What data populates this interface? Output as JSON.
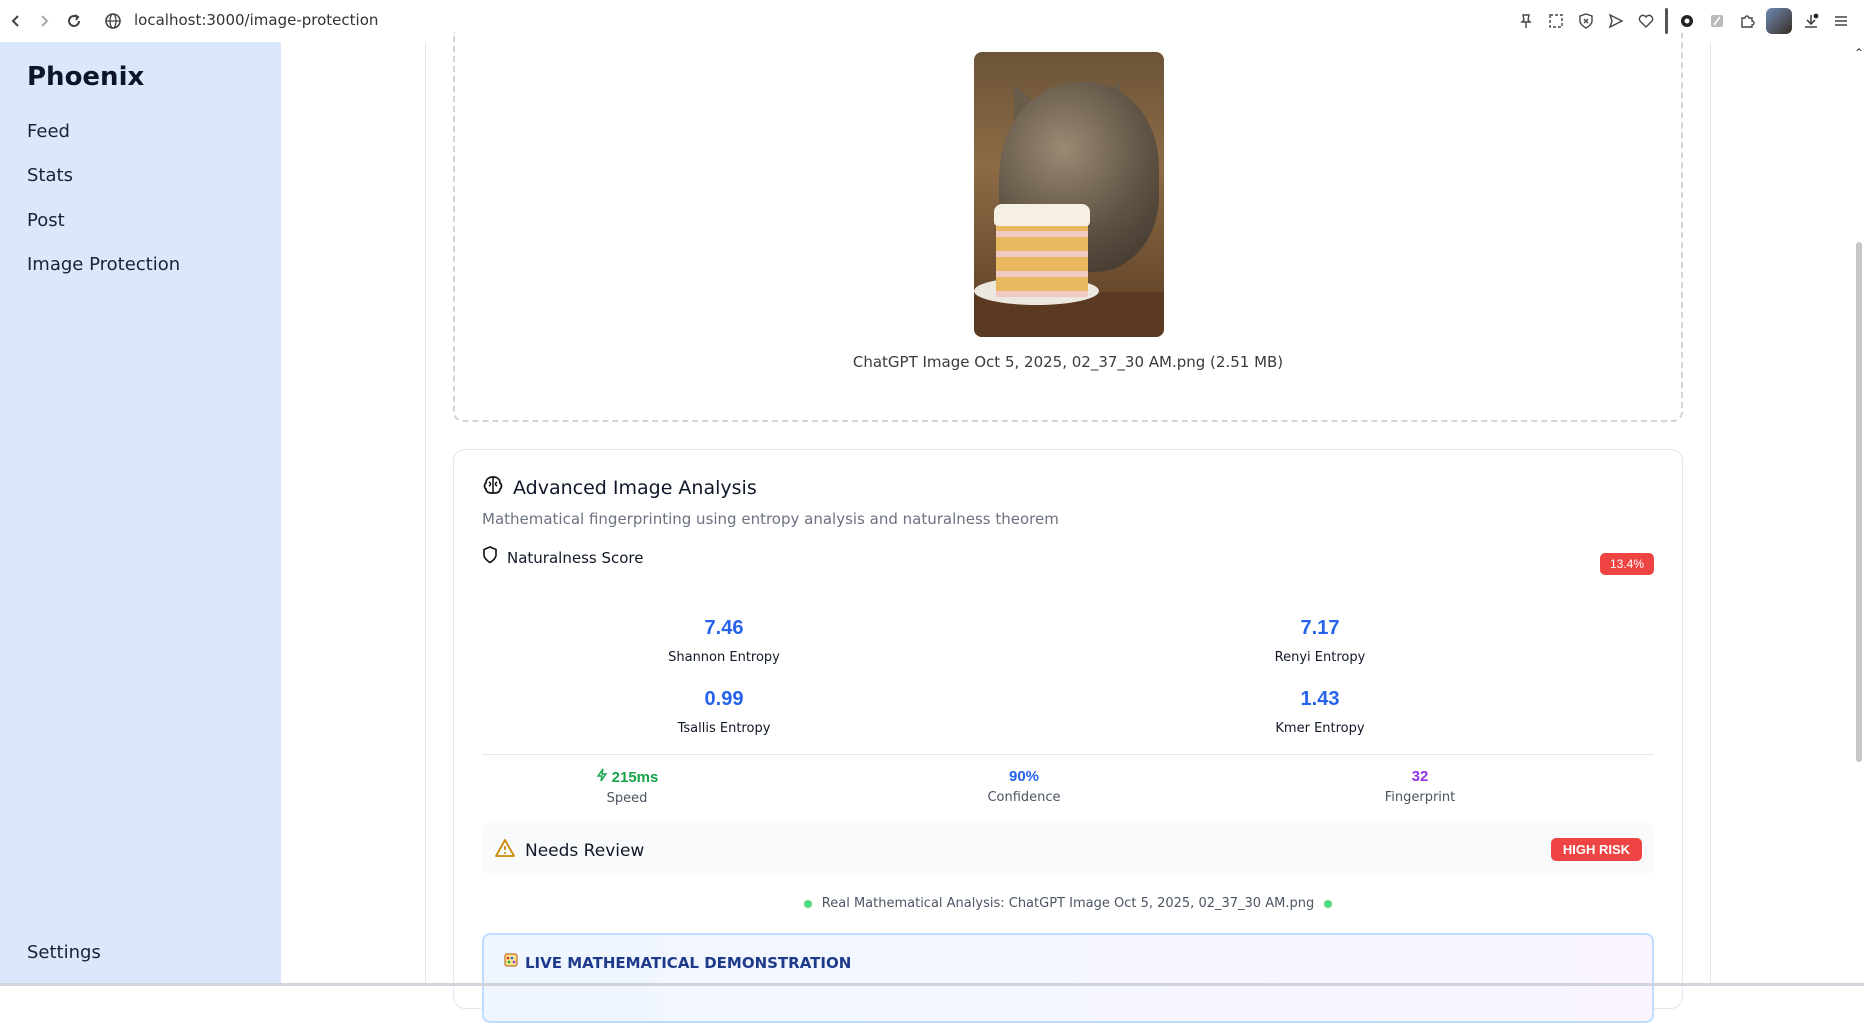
{
  "browser": {
    "url": "localhost:3000/image-protection"
  },
  "sidebar": {
    "brand": "Phoenix",
    "items": [
      {
        "label": "Feed"
      },
      {
        "label": "Stats"
      },
      {
        "label": "Post"
      },
      {
        "label": "Image Protection"
      }
    ],
    "settings_label": "Settings"
  },
  "upload": {
    "file_caption": "ChatGPT Image Oct 5, 2025, 02_37_30 AM.png (2.51 MB)"
  },
  "analysis": {
    "title": "Advanced Image Analysis",
    "subtitle": "Mathematical fingerprinting using entropy analysis and naturalness theorem",
    "naturalness_label": "Naturalness Score",
    "naturalness_value": "13.4%",
    "metrics": {
      "shannon": {
        "value": "7.46",
        "label": "Shannon Entropy"
      },
      "renyi": {
        "value": "7.17",
        "label": "Renyi Entropy"
      },
      "tsallis": {
        "value": "0.99",
        "label": "Tsallis Entropy"
      },
      "kmer": {
        "value": "1.43",
        "label": "Kmer Entropy"
      }
    },
    "stats": {
      "speed": {
        "value": "215ms",
        "label": "Speed"
      },
      "confidence": {
        "value": "90%",
        "label": "Confidence"
      },
      "fingerprint": {
        "value": "32",
        "label": "Fingerprint"
      }
    },
    "review": {
      "title": "Needs Review",
      "risk": "HIGH RISK"
    },
    "real_analysis_text": "Real Mathematical Analysis: ChatGPT Image Oct 5, 2025, 02_37_30 AM.png",
    "demo_title": "LIVE MATHEMATICAL DEMONSTRATION"
  },
  "colors": {
    "sidebar_bg": "#dbe8fc",
    "accent_blue": "#2563eb",
    "danger": "#ef4444",
    "success": "#16a34a",
    "purple": "#9333ea"
  }
}
